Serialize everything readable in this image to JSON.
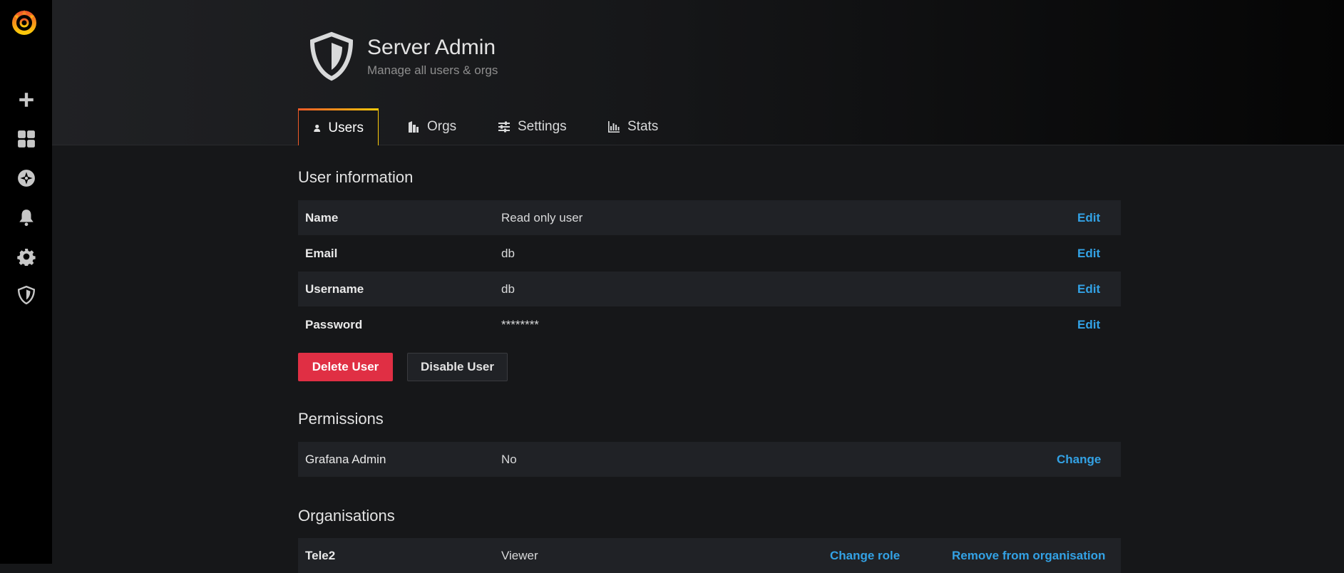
{
  "sidemenu": {
    "logo": "grafana-logo-icon",
    "items": [
      {
        "name": "plus-icon",
        "label": "Create"
      },
      {
        "name": "dashboards-grid-icon",
        "label": "Dashboards"
      },
      {
        "name": "explore-compass-icon",
        "label": "Explore"
      },
      {
        "name": "bell-icon",
        "label": "Alerting"
      },
      {
        "name": "gear-icon",
        "label": "Configuration"
      },
      {
        "name": "shield-icon",
        "label": "Server Admin"
      }
    ]
  },
  "header": {
    "title": "Server Admin",
    "subtitle": "Manage all users & orgs"
  },
  "tabs": [
    {
      "label": "Users",
      "active": true
    },
    {
      "label": "Orgs",
      "active": false
    },
    {
      "label": "Settings",
      "active": false
    },
    {
      "label": "Stats",
      "active": false
    }
  ],
  "user_info": {
    "title": "User information",
    "rows": [
      {
        "label": "Name",
        "value": "Read only user",
        "action": "Edit"
      },
      {
        "label": "Email",
        "value": "db",
        "action": "Edit"
      },
      {
        "label": "Username",
        "value": "db",
        "action": "Edit"
      },
      {
        "label": "Password",
        "value": "********",
        "action": "Edit"
      }
    ],
    "delete_button": "Delete User",
    "disable_button": "Disable User"
  },
  "permissions": {
    "title": "Permissions",
    "label": "Grafana Admin",
    "value": "No",
    "action": "Change"
  },
  "organisations": {
    "title": "Organisations",
    "rows": [
      {
        "name": "Tele2",
        "role": "Viewer",
        "change_role": "Change role",
        "remove": "Remove from organisation"
      }
    ]
  },
  "colors": {
    "accent_link": "#33a2e5",
    "danger": "#e02f44",
    "background": "#161719",
    "sidebar": "#000000"
  }
}
